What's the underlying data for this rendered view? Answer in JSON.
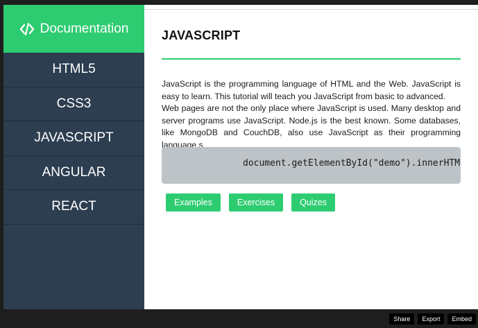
{
  "sidebar": {
    "brand": {
      "icon": "code-icon",
      "label": "Documentation"
    },
    "items": [
      {
        "label": "HTML5"
      },
      {
        "label": "CSS3"
      },
      {
        "label": "JAVASCRIPT"
      },
      {
        "label": "ANGULAR"
      },
      {
        "label": "REACT"
      }
    ]
  },
  "main": {
    "title": "JAVASCRIPT",
    "paragraph1": "JavaScript is the programming language of HTML and the Web. JavaScript is easy to learn. This tutorial will teach you JavaScript from basic to advanced.",
    "paragraph2": "Web pages are not the only place where JavaScript is used. Many desktop and server programs use JavaScript. Node.js is the best known. Some databases, like MongoDB and CouchDB, also use JavaScript as their programming language.s",
    "code": "document.getElementById(\"demo\").innerHTML",
    "buttons": [
      {
        "label": "Examples"
      },
      {
        "label": "Exercises"
      },
      {
        "label": "Quizes"
      }
    ]
  },
  "bottom_bar": {
    "share": "Share",
    "export": "Export",
    "embed": "Embed"
  },
  "colors": {
    "accent": "#2ecc71",
    "sidebar": "#2c3e50",
    "code_bg": "#bdc3c7",
    "frame": "#1e1e1e"
  }
}
